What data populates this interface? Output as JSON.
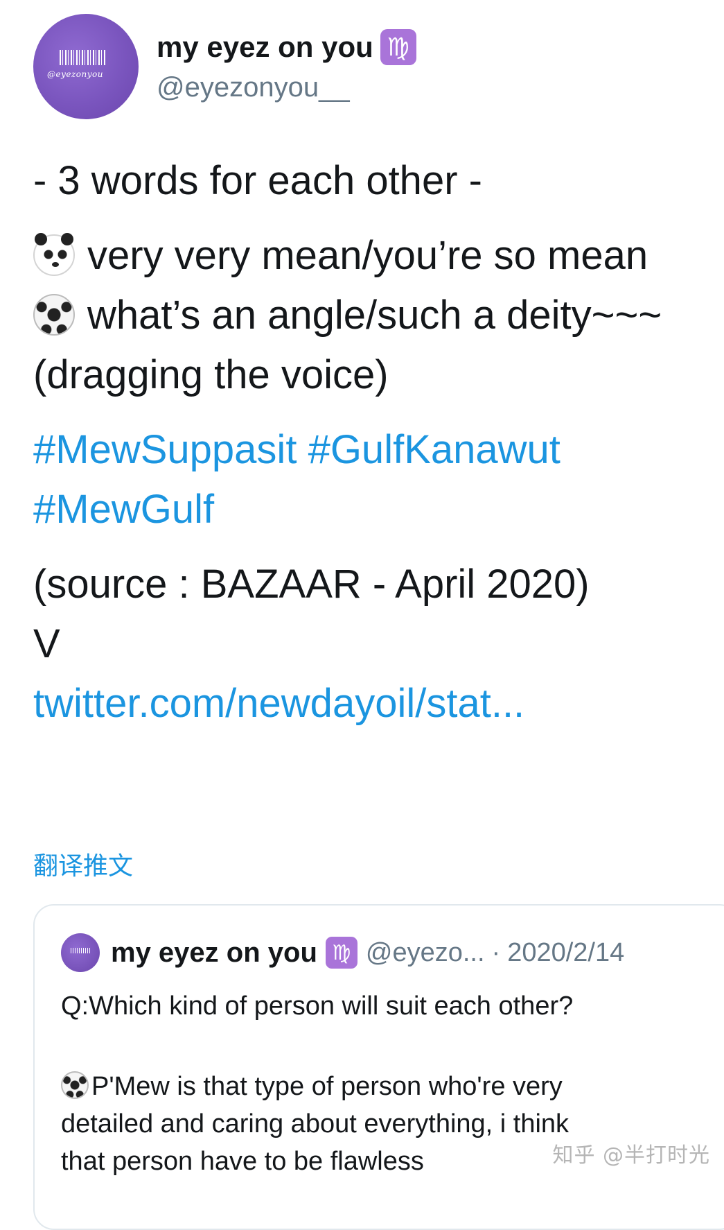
{
  "profile": {
    "avatar_caption": "@eyezonyou",
    "display_name": "my eyez on you",
    "zodiac_badge": "♍",
    "handle": "@eyezonyou__"
  },
  "tweet": {
    "heading": "- 3 words for each other -",
    "panda_line": "very very mean/you’re so mean",
    "ball_line": "what’s an angle/such a deity~~~",
    "ball_line_cont": "(dragging the voice)",
    "hashtag_1": "#MewSuppasit",
    "hashtag_2": "#GulfKanawut",
    "hashtag_3": "#MewGulf",
    "source": "(source : BAZAAR - April 2020)",
    "v": "V",
    "url": "twitter.com/newdayoil/stat..."
  },
  "translate_label": "翻译推文",
  "quoted": {
    "display_name": "my eyez on you",
    "zodiac_badge": "♍",
    "handle": "@eyezo...",
    "separator": "·",
    "date": "2020/2/14",
    "question": "Q:Which kind of person will suit each other?",
    "answer_lines": [
      "P'Mew is that type of person who're very",
      "detailed and caring about everything, i think",
      "that person have to be flawless"
    ]
  },
  "watermark": "知乎 @半打时光",
  "colors": {
    "link": "#1b95e0",
    "text": "#14171a",
    "muted": "#657786",
    "avatar": "#7a55be",
    "zodiac": "#a974d9"
  },
  "icons": [
    "panda-emoji-icon",
    "soccer-ball-emoji-icon",
    "virgo-zodiac-icon"
  ]
}
